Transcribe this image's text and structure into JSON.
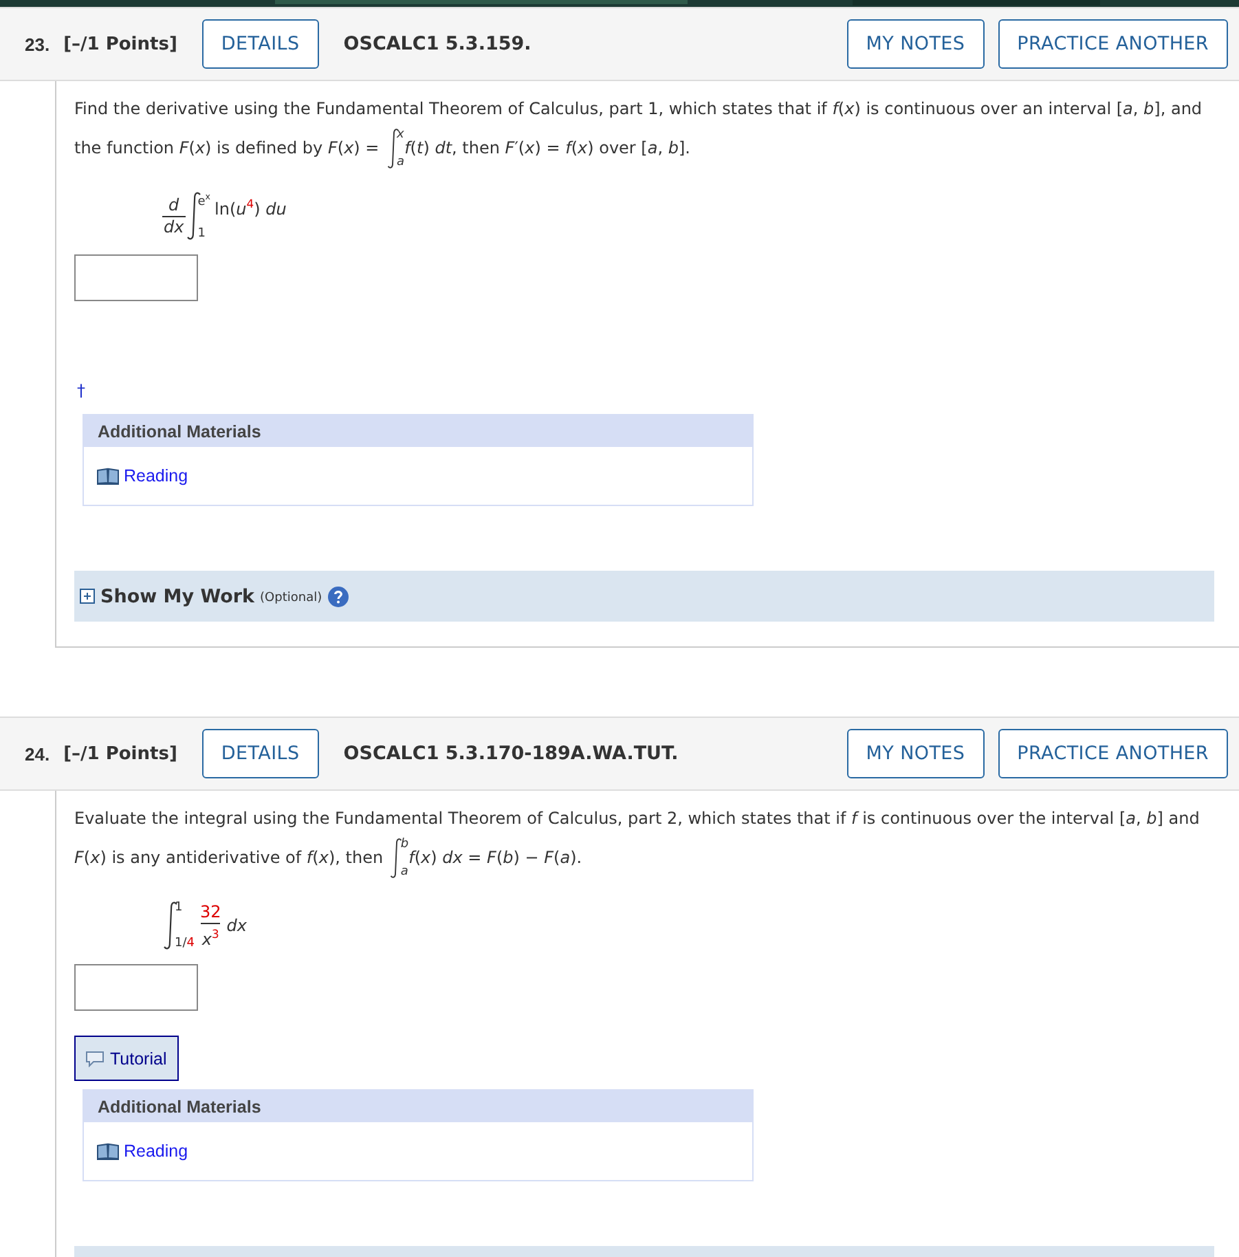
{
  "problems": [
    {
      "number": "23.",
      "points": "[–/1 Points]",
      "details": "DETAILS",
      "code": "OSCALC1 5.3.159.",
      "notes": "MY NOTES",
      "practice": "PRACTICE ANOTHER",
      "intro_before": "Find the derivative using the Fundamental Theorem of Calculus, part 1, which states that if *f*(*x*) is continuous over an interval [*a*, *b*], and the function *F*(*x*) is defined by *F*(*x*) = ",
      "intro_upper": "*x*",
      "intro_lower": "*a*",
      "intro_after": "*f*(*t*) *dt*, then *F*′(*x*) = *f*(*x*) over [*a*, *b*].",
      "expression": {
        "kind": "derivative",
        "num": "*d*",
        "den": "*dx*",
        "upper": "e$^{x}$",
        "lower": "1",
        "integrand": "ln(*u*$^{4}$) *du*"
      },
      "footnote_mark": "†",
      "materials_title": "Additional Materials",
      "materials_link": "Reading",
      "show_work": {
        "title": "Show My Work",
        "note": "(Optional)"
      }
    },
    {
      "number": "24.",
      "points": "[–/1 Points]",
      "details": "DETAILS",
      "code": "OSCALC1 5.3.170-189A.WA.TUT.",
      "notes": "MY NOTES",
      "practice": "PRACTICE ANOTHER",
      "intro_before": "Evaluate the integral using the Fundamental Theorem of Calculus, part 2, which states that if *f* is continuous over the interval [*a*, *b*] and *F*(*x*) is any antiderivative of *f*(*x*), then ",
      "intro_upper": "*b*",
      "intro_lower": "*a*",
      "intro_after": "*f*(*x*) *dx* = *F*(*b*) − *F*(*a*).",
      "expression": {
        "kind": "definite",
        "upper": "1",
        "lower": "1/",
        "lower_param": "4",
        "num": "32",
        "den": "*x*$^{3}$",
        "integrand": "*dx*"
      },
      "tutorial": "Tutorial",
      "materials_title": "Additional Materials",
      "materials_link": "Reading"
    }
  ]
}
